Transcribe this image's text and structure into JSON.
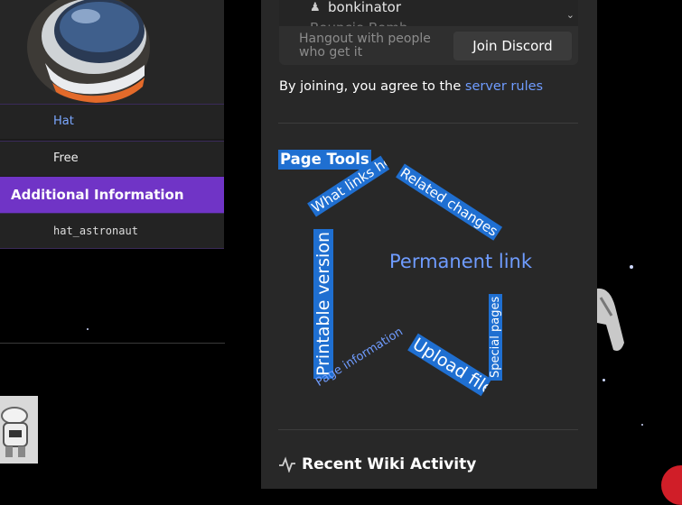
{
  "infobox": {
    "type_value": "Hat",
    "cost_value": "Free",
    "section_header": "Additional Information",
    "id_value": "hat_astronaut"
  },
  "discord_widget": {
    "members": [
      "bonkinator",
      "Bouncie Bomb"
    ],
    "hangout_text": "Hangout with people who get it",
    "join_button": "Join Discord"
  },
  "agree_text": "By joining, you agree to the ",
  "server_rules_link": "server rules",
  "page_tools": {
    "title": "Page Tools",
    "links": {
      "what_links_here": "What links here",
      "related_changes": "Related changes",
      "permanent_link": "Permanent link",
      "printable_version": "Printable version",
      "page_information": "Page information",
      "upload_file": "Upload file",
      "special_pages": "Special pages"
    }
  },
  "recent_activity": {
    "title": "Recent Wiki Activity",
    "icon": "activity-icon"
  },
  "colors": {
    "accent_purple": "#7034c6",
    "highlight_blue": "#1f6fd1",
    "link_blue": "#6f9cff",
    "fab_red": "#d01e28"
  }
}
